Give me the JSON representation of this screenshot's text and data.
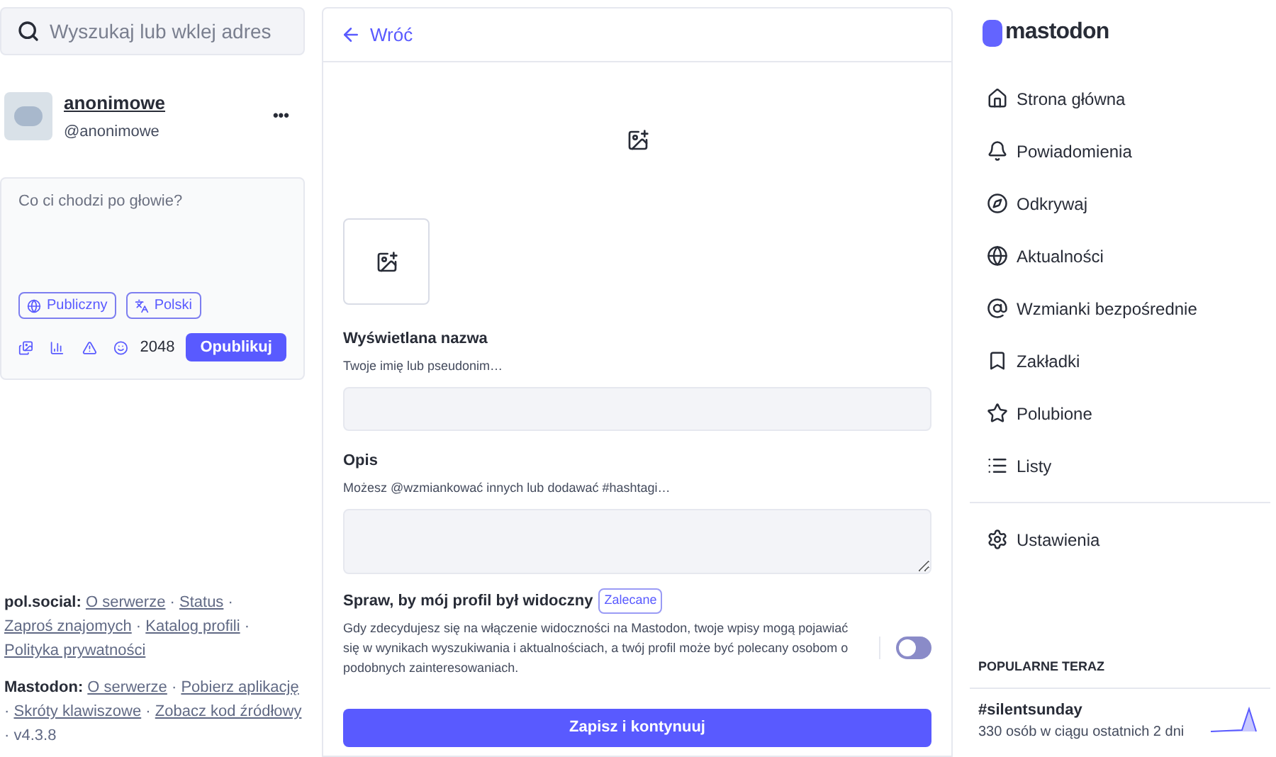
{
  "search": {
    "placeholder": "Wyszukaj lub wklej adres"
  },
  "account": {
    "display_name": "anonimowe",
    "handle": "@anonimowe",
    "menu": "•••"
  },
  "compose": {
    "placeholder": "Co ci chodzi po głowie?",
    "visibility": "Publiczny",
    "language": "Polski",
    "char_count": "2048",
    "publish": "Opublikuj"
  },
  "footer": [
    {
      "label": "pol.social:",
      "separator": "·",
      "links": [
        "O serwerze",
        "Status",
        "Zaproś znajomych",
        "Katalog profili",
        "Polityka prywatności"
      ]
    },
    {
      "label": "Mastodon:",
      "separator": "·",
      "links": [
        "O serwerze",
        "Pobierz aplikację",
        "Skróty klawiszowe",
        "Zobacz kod źródłowy"
      ],
      "version": "v4.3.8"
    }
  ],
  "back": "Wróć",
  "form": {
    "display_name": {
      "label": "Wyświetlana nazwa",
      "hint": "Twoje imię lub pseudonim…"
    },
    "bio": {
      "label": "Opis",
      "hint": "Możesz @wzmiankować innych lub dodawać #hashtagi…"
    },
    "discoverable": {
      "label": "Spraw, by mój profil był widoczny",
      "badge": "Zalecane",
      "hint": "Gdy zdecydujesz się na włączenie widoczności na Mastodon, twoje wpisy mogą pojawiać się w wynikach wyszukiwania i aktualnościach, a twój profil może być polecany osobom o podobnych zainteresowaniach.",
      "on": false
    },
    "submit": "Zapisz i kontynuuj"
  },
  "logo": "mastodon",
  "nav": [
    {
      "label": "Strona główna",
      "kind": "home"
    },
    {
      "label": "Powiadomienia",
      "kind": "bell"
    },
    {
      "label": "Odkrywaj",
      "kind": "compass"
    },
    {
      "label": "Aktualności",
      "kind": "globe"
    },
    {
      "label": "Wzmianki bezpośrednie",
      "kind": "at"
    },
    {
      "label": "Zakładki",
      "kind": "bookmarks"
    },
    {
      "label": "Polubione",
      "kind": "star"
    },
    {
      "label": "Listy",
      "kind": "list"
    }
  ],
  "settings": "Ustawienia",
  "trending": {
    "title": "POPULARNE TERAZ",
    "items": [
      {
        "tag": "#silentsunday",
        "stats": "330 osób w ciągu ostatnich 2 dni"
      }
    ]
  }
}
